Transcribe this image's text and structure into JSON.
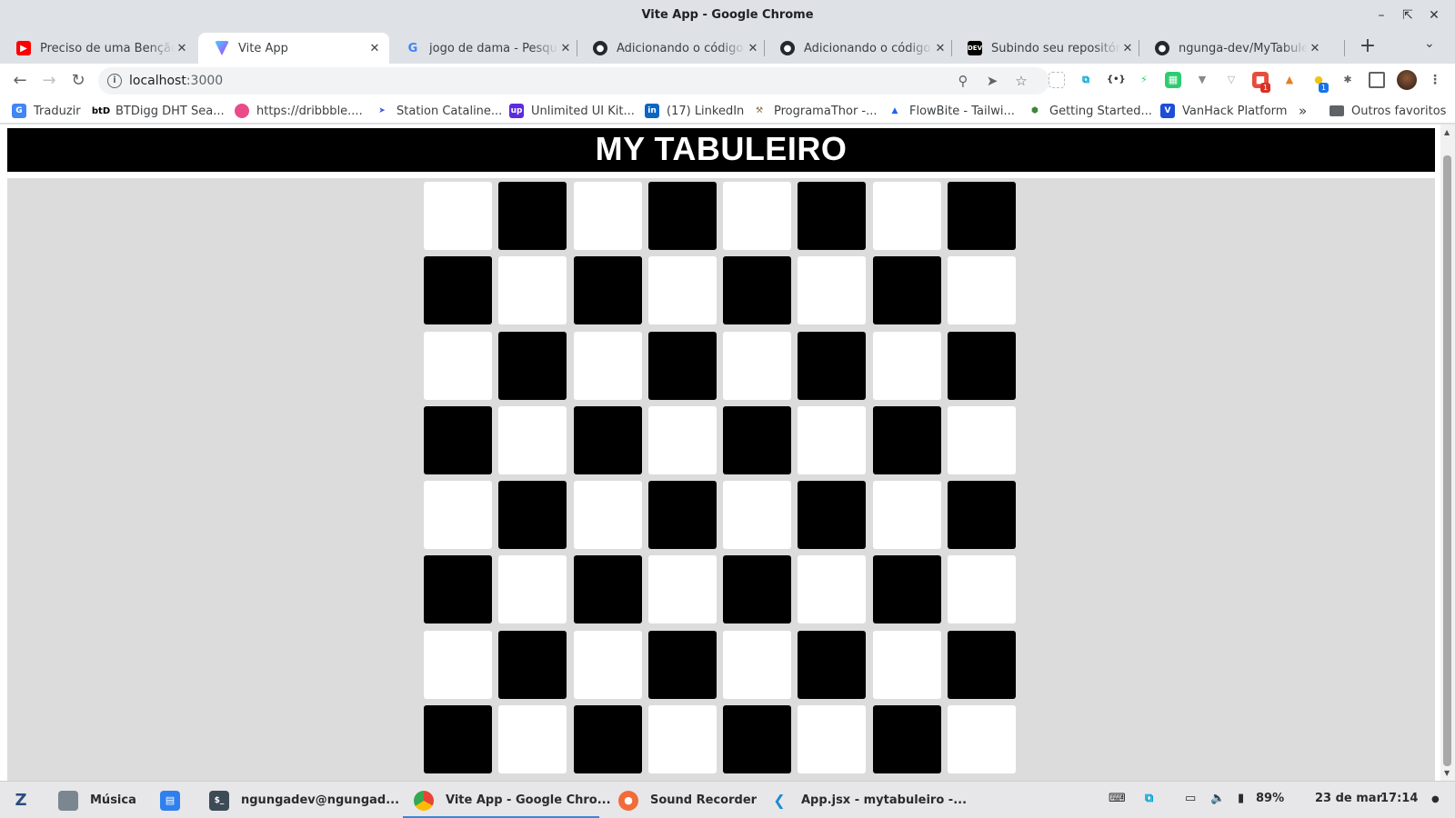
{
  "window": {
    "title": "Vite App - Google Chrome"
  },
  "tabs": [
    {
      "label": "Preciso de uma Benção",
      "icon": "youtube-icon",
      "active": false
    },
    {
      "label": "Vite App",
      "icon": "vite-icon",
      "active": true
    },
    {
      "label": "jogo de dama - Pesquisa",
      "icon": "google-icon",
      "active": false
    },
    {
      "label": "Adicionando o código local",
      "icon": "github-icon",
      "active": false
    },
    {
      "label": "Adicionando o código local",
      "icon": "github-icon",
      "active": false
    },
    {
      "label": "Subindo seu repositório",
      "icon": "dev-icon",
      "active": false
    },
    {
      "label": "ngunga-dev/MyTabuleiro",
      "icon": "github-icon",
      "active": false
    }
  ],
  "address_bar": {
    "host": "localhost",
    "port": ":3000"
  },
  "bookmarks": [
    {
      "label": "Traduzir",
      "icon": "translate-icon"
    },
    {
      "label": "BTDigg DHT Sea...",
      "icon": "btdigg-icon"
    },
    {
      "label": "https://dribbble....",
      "icon": "dribbble-icon"
    },
    {
      "label": "Station Cataline...",
      "icon": "rocket-icon"
    },
    {
      "label": "Unlimited UI Kit...",
      "icon": "ui-kit-icon"
    },
    {
      "label": "(17) LinkedIn",
      "icon": "linkedin-icon"
    },
    {
      "label": "ProgramaThor -...",
      "icon": "hammer-icon"
    },
    {
      "label": "FlowBite - Tailwi...",
      "icon": "flowbite-icon"
    },
    {
      "label": "Getting Started...",
      "icon": "node-icon"
    },
    {
      "label": "VanHack Platform",
      "icon": "vanhack-icon"
    }
  ],
  "bookmarks_overflow": "»",
  "other_bookmarks": "Outros favoritos",
  "extensions": {
    "badge_red": "1",
    "badge_blue": "1"
  },
  "page": {
    "heading": "MY TABULEIRO",
    "board": {
      "rows": 8,
      "cols": 8,
      "first_cell": "light",
      "light_color": "#ffffff",
      "dark_color": "#000000"
    }
  },
  "taskbar": {
    "items": [
      {
        "label": "Música",
        "icon": "folder-icon",
        "active": false
      },
      {
        "label": "",
        "icon": "store-icon",
        "active": false
      },
      {
        "label": "ngungadev@ngungad...",
        "icon": "terminal-icon",
        "active": false
      },
      {
        "label": "Vite App - Google Chro...",
        "icon": "chrome-icon",
        "active": true
      },
      {
        "label": "Sound Recorder",
        "icon": "microphone-icon",
        "active": false
      },
      {
        "label": "App.jsx - mytabuleiro -...",
        "icon": "vscode-icon",
        "active": false
      }
    ],
    "battery": "89%",
    "date": "23 de mar",
    "time": "17:14"
  }
}
